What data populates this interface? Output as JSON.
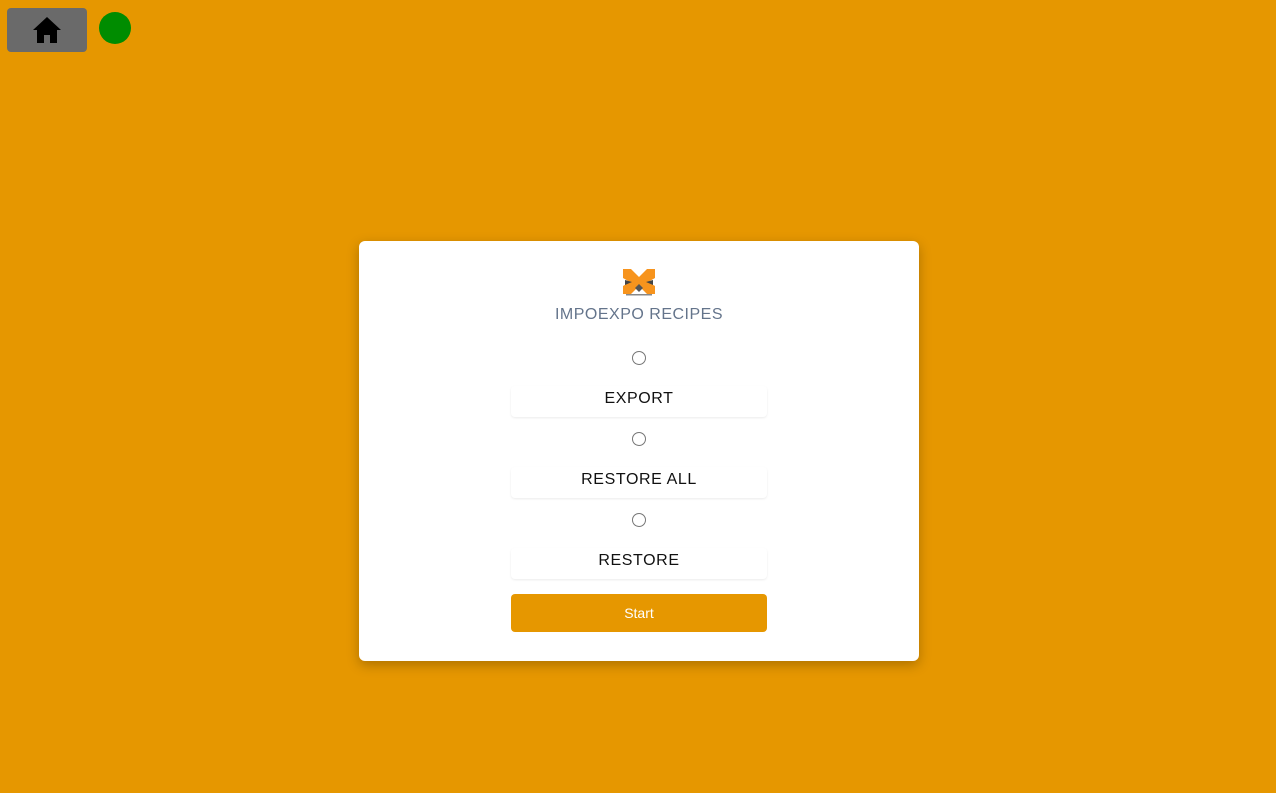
{
  "topbar": {
    "home_icon": "home-icon",
    "status_color": "#008c00"
  },
  "card": {
    "title": "IMPOEXPO RECIPES",
    "logo_icon": "tmg-logo",
    "options": [
      {
        "label": "EXPORT",
        "selected": false
      },
      {
        "label": "RESTORE ALL",
        "selected": false
      },
      {
        "label": "RESTORE",
        "selected": false
      }
    ],
    "start_label": "Start"
  },
  "colors": {
    "background": "#e69700",
    "accent": "#e69700",
    "home_button": "#6a6a6a",
    "title": "#64748b"
  }
}
